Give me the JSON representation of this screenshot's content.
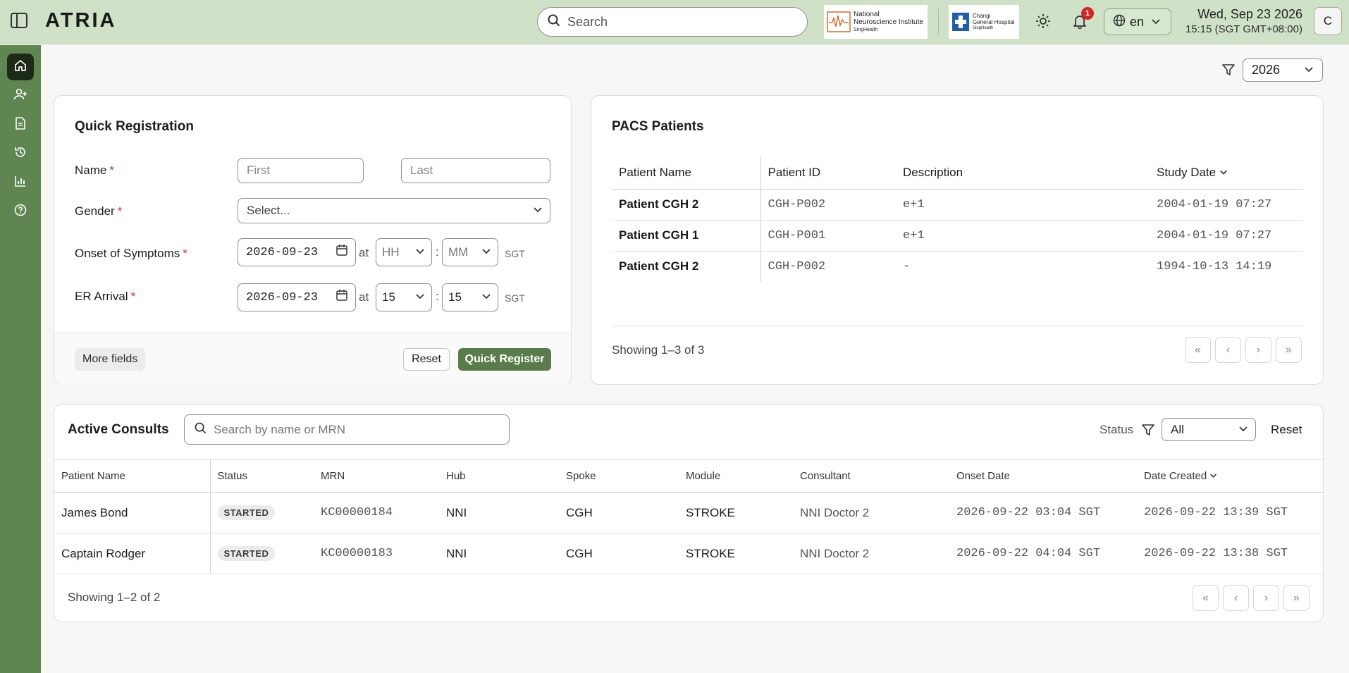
{
  "header": {
    "title": "ATRIA",
    "search_placeholder": "Search",
    "logo_nni": {
      "line1": "National",
      "line2": "Neuroscience Institute",
      "line3": "SingHealth"
    },
    "logo_cgh": {
      "line1": "Changi",
      "line2": "General Hospital",
      "line3": "SingHealth"
    },
    "notification_count": "1",
    "language": "en",
    "date": "Wed, Sep 23 2026",
    "time": "15:15 (SGT GMT+08:00)",
    "avatar_initial": "C"
  },
  "sidebar": {
    "items": [
      {
        "icon": "home-icon",
        "active": true
      },
      {
        "icon": "add-user-icon",
        "active": false
      },
      {
        "icon": "document-icon",
        "active": false
      },
      {
        "icon": "history-icon",
        "active": false
      },
      {
        "icon": "chart-icon",
        "active": false
      },
      {
        "icon": "help-icon",
        "active": false
      }
    ]
  },
  "year_filter": {
    "value": "2026"
  },
  "quick_registration": {
    "title": "Quick Registration",
    "name_label": "Name",
    "first_placeholder": "First",
    "last_placeholder": "Last",
    "gender_label": "Gender",
    "gender_placeholder": "Select...",
    "onset_label": "Onset of Symptoms",
    "onset_date": "2026-09-23",
    "onset_hour": "HH",
    "onset_minute": "MM",
    "er_label": "ER Arrival",
    "er_date": "2026-09-23",
    "er_hour": "15",
    "er_minute": "15",
    "at": "at",
    "tz": "SGT",
    "required_mark": "*",
    "more_fields": "More fields",
    "reset": "Reset",
    "submit": "Quick Register"
  },
  "pacs": {
    "title": "PACS Patients",
    "columns": [
      "Patient Name",
      "Patient ID",
      "Description",
      "Study Date"
    ],
    "rows": [
      {
        "name": "Patient CGH 2",
        "id": "CGH-P002",
        "desc": "e+1",
        "date": "2004-01-19 07:27"
      },
      {
        "name": "Patient CGH 1",
        "id": "CGH-P001",
        "desc": "e+1",
        "date": "2004-01-19 07:27"
      },
      {
        "name": "Patient CGH 2",
        "id": "CGH-P002",
        "desc": "-",
        "date": "1994-10-13 14:19"
      }
    ],
    "showing": "Showing 1–3 of 3"
  },
  "consults": {
    "title": "Active Consults",
    "search_placeholder": "Search by name or MRN",
    "status_label": "Status",
    "status_value": "All",
    "reset": "Reset",
    "columns": [
      "Patient Name",
      "Status",
      "MRN",
      "Hub",
      "Spoke",
      "Module",
      "Consultant",
      "Onset Date",
      "Date Created"
    ],
    "rows": [
      {
        "name": "James Bond",
        "status": "STARTED",
        "mrn": "KC00000184",
        "hub": "NNI",
        "spoke": "CGH",
        "module": "STROKE",
        "consultant": "NNI Doctor 2",
        "onset": "2026-09-22 03:04 SGT",
        "created": "2026-09-22 13:39 SGT"
      },
      {
        "name": "Captain Rodger",
        "status": "STARTED",
        "mrn": "KC00000183",
        "hub": "NNI",
        "spoke": "CGH",
        "module": "STROKE",
        "consultant": "NNI Doctor 2",
        "onset": "2026-09-22 04:04 SGT",
        "created": "2026-09-22 13:38 SGT"
      }
    ],
    "showing": "Showing 1–2 of 2"
  },
  "colors": {
    "header_bg": "#cfe2c8",
    "sidebar_bg": "#5f8551",
    "primary": "#5a7c4d",
    "required": "#d03232"
  }
}
